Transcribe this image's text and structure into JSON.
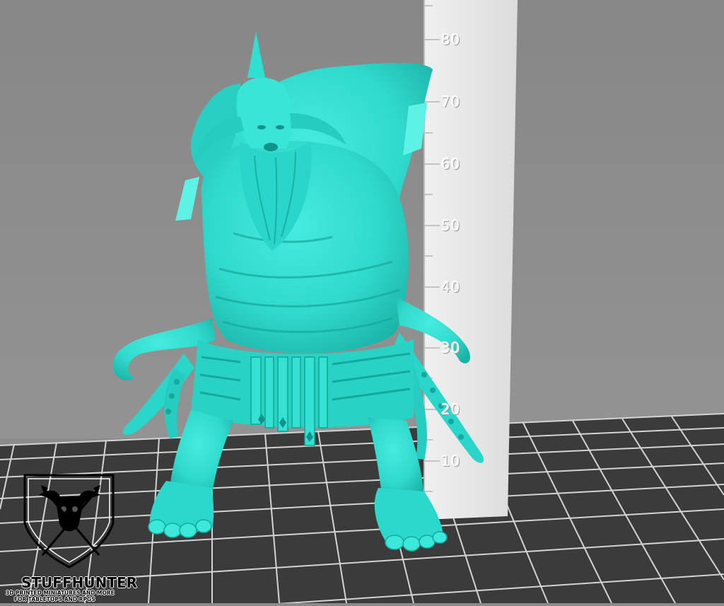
{
  "ruler": {
    "labels": [
      "80",
      "70",
      "60",
      "50",
      "40",
      "30",
      "20",
      "10"
    ]
  },
  "logo": {
    "title": "STUFFHUNTER",
    "subtitle_line1": "3D PRINTED MINIATURES AND MORE",
    "subtitle_line2": "FOR TABLETOPS AND RPGS"
  },
  "colors": {
    "model": "#2fe0d0",
    "model_shadow": "#14a99d",
    "background": "#8b8b8b",
    "floor": "#3a3a3a",
    "grid": "#cfcfcf",
    "ruler": "#e6e6e6"
  }
}
